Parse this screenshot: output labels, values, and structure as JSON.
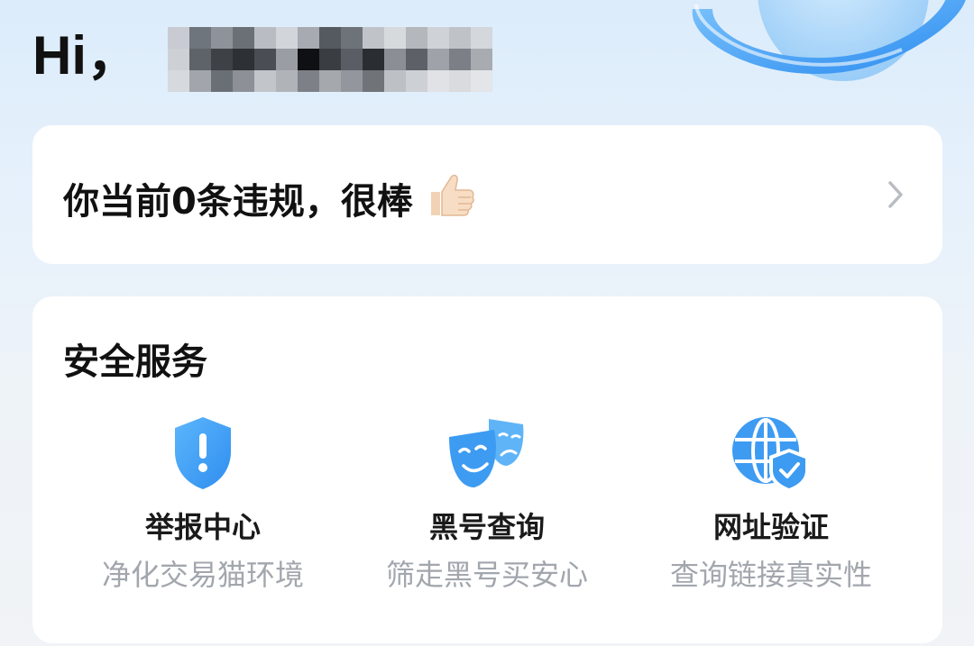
{
  "header": {
    "greeting": "Hi，",
    "username_blurred": true
  },
  "violation_card": {
    "text": "你当前0条违规，很棒",
    "emoji": "thumbs-up-icon",
    "chevron": "chevron-right-icon"
  },
  "security_services": {
    "title": "安全服务",
    "items": [
      {
        "icon": "shield-alert-icon",
        "title": "举报中心",
        "subtitle": "净化交易猫环境"
      },
      {
        "icon": "drama-masks-icon",
        "title": "黑号查询",
        "subtitle": "筛走黑号买安心"
      },
      {
        "icon": "globe-shield-icon",
        "title": "网址验证",
        "subtitle": "查询链接真实性"
      }
    ]
  },
  "colors": {
    "accent_blue": "#3d9bf2",
    "text_primary": "#111111",
    "text_secondary": "#a2a6ad"
  }
}
